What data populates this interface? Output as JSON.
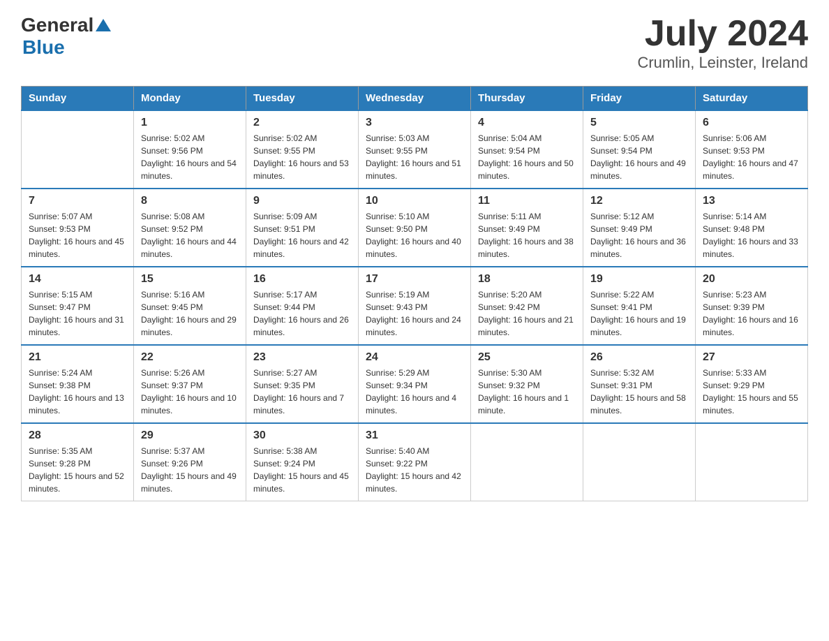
{
  "header": {
    "logo_general": "General",
    "logo_blue": "Blue",
    "month_year": "July 2024",
    "location": "Crumlin, Leinster, Ireland"
  },
  "days_of_week": [
    "Sunday",
    "Monday",
    "Tuesday",
    "Wednesday",
    "Thursday",
    "Friday",
    "Saturday"
  ],
  "weeks": [
    [
      {
        "day": "",
        "sunrise": "",
        "sunset": "",
        "daylight": ""
      },
      {
        "day": "1",
        "sunrise": "Sunrise: 5:02 AM",
        "sunset": "Sunset: 9:56 PM",
        "daylight": "Daylight: 16 hours and 54 minutes."
      },
      {
        "day": "2",
        "sunrise": "Sunrise: 5:02 AM",
        "sunset": "Sunset: 9:55 PM",
        "daylight": "Daylight: 16 hours and 53 minutes."
      },
      {
        "day": "3",
        "sunrise": "Sunrise: 5:03 AM",
        "sunset": "Sunset: 9:55 PM",
        "daylight": "Daylight: 16 hours and 51 minutes."
      },
      {
        "day": "4",
        "sunrise": "Sunrise: 5:04 AM",
        "sunset": "Sunset: 9:54 PM",
        "daylight": "Daylight: 16 hours and 50 minutes."
      },
      {
        "day": "5",
        "sunrise": "Sunrise: 5:05 AM",
        "sunset": "Sunset: 9:54 PM",
        "daylight": "Daylight: 16 hours and 49 minutes."
      },
      {
        "day": "6",
        "sunrise": "Sunrise: 5:06 AM",
        "sunset": "Sunset: 9:53 PM",
        "daylight": "Daylight: 16 hours and 47 minutes."
      }
    ],
    [
      {
        "day": "7",
        "sunrise": "Sunrise: 5:07 AM",
        "sunset": "Sunset: 9:53 PM",
        "daylight": "Daylight: 16 hours and 45 minutes."
      },
      {
        "day": "8",
        "sunrise": "Sunrise: 5:08 AM",
        "sunset": "Sunset: 9:52 PM",
        "daylight": "Daylight: 16 hours and 44 minutes."
      },
      {
        "day": "9",
        "sunrise": "Sunrise: 5:09 AM",
        "sunset": "Sunset: 9:51 PM",
        "daylight": "Daylight: 16 hours and 42 minutes."
      },
      {
        "day": "10",
        "sunrise": "Sunrise: 5:10 AM",
        "sunset": "Sunset: 9:50 PM",
        "daylight": "Daylight: 16 hours and 40 minutes."
      },
      {
        "day": "11",
        "sunrise": "Sunrise: 5:11 AM",
        "sunset": "Sunset: 9:49 PM",
        "daylight": "Daylight: 16 hours and 38 minutes."
      },
      {
        "day": "12",
        "sunrise": "Sunrise: 5:12 AM",
        "sunset": "Sunset: 9:49 PM",
        "daylight": "Daylight: 16 hours and 36 minutes."
      },
      {
        "day": "13",
        "sunrise": "Sunrise: 5:14 AM",
        "sunset": "Sunset: 9:48 PM",
        "daylight": "Daylight: 16 hours and 33 minutes."
      }
    ],
    [
      {
        "day": "14",
        "sunrise": "Sunrise: 5:15 AM",
        "sunset": "Sunset: 9:47 PM",
        "daylight": "Daylight: 16 hours and 31 minutes."
      },
      {
        "day": "15",
        "sunrise": "Sunrise: 5:16 AM",
        "sunset": "Sunset: 9:45 PM",
        "daylight": "Daylight: 16 hours and 29 minutes."
      },
      {
        "day": "16",
        "sunrise": "Sunrise: 5:17 AM",
        "sunset": "Sunset: 9:44 PM",
        "daylight": "Daylight: 16 hours and 26 minutes."
      },
      {
        "day": "17",
        "sunrise": "Sunrise: 5:19 AM",
        "sunset": "Sunset: 9:43 PM",
        "daylight": "Daylight: 16 hours and 24 minutes."
      },
      {
        "day": "18",
        "sunrise": "Sunrise: 5:20 AM",
        "sunset": "Sunset: 9:42 PM",
        "daylight": "Daylight: 16 hours and 21 minutes."
      },
      {
        "day": "19",
        "sunrise": "Sunrise: 5:22 AM",
        "sunset": "Sunset: 9:41 PM",
        "daylight": "Daylight: 16 hours and 19 minutes."
      },
      {
        "day": "20",
        "sunrise": "Sunrise: 5:23 AM",
        "sunset": "Sunset: 9:39 PM",
        "daylight": "Daylight: 16 hours and 16 minutes."
      }
    ],
    [
      {
        "day": "21",
        "sunrise": "Sunrise: 5:24 AM",
        "sunset": "Sunset: 9:38 PM",
        "daylight": "Daylight: 16 hours and 13 minutes."
      },
      {
        "day": "22",
        "sunrise": "Sunrise: 5:26 AM",
        "sunset": "Sunset: 9:37 PM",
        "daylight": "Daylight: 16 hours and 10 minutes."
      },
      {
        "day": "23",
        "sunrise": "Sunrise: 5:27 AM",
        "sunset": "Sunset: 9:35 PM",
        "daylight": "Daylight: 16 hours and 7 minutes."
      },
      {
        "day": "24",
        "sunrise": "Sunrise: 5:29 AM",
        "sunset": "Sunset: 9:34 PM",
        "daylight": "Daylight: 16 hours and 4 minutes."
      },
      {
        "day": "25",
        "sunrise": "Sunrise: 5:30 AM",
        "sunset": "Sunset: 9:32 PM",
        "daylight": "Daylight: 16 hours and 1 minute."
      },
      {
        "day": "26",
        "sunrise": "Sunrise: 5:32 AM",
        "sunset": "Sunset: 9:31 PM",
        "daylight": "Daylight: 15 hours and 58 minutes."
      },
      {
        "day": "27",
        "sunrise": "Sunrise: 5:33 AM",
        "sunset": "Sunset: 9:29 PM",
        "daylight": "Daylight: 15 hours and 55 minutes."
      }
    ],
    [
      {
        "day": "28",
        "sunrise": "Sunrise: 5:35 AM",
        "sunset": "Sunset: 9:28 PM",
        "daylight": "Daylight: 15 hours and 52 minutes."
      },
      {
        "day": "29",
        "sunrise": "Sunrise: 5:37 AM",
        "sunset": "Sunset: 9:26 PM",
        "daylight": "Daylight: 15 hours and 49 minutes."
      },
      {
        "day": "30",
        "sunrise": "Sunrise: 5:38 AM",
        "sunset": "Sunset: 9:24 PM",
        "daylight": "Daylight: 15 hours and 45 minutes."
      },
      {
        "day": "31",
        "sunrise": "Sunrise: 5:40 AM",
        "sunset": "Sunset: 9:22 PM",
        "daylight": "Daylight: 15 hours and 42 minutes."
      },
      {
        "day": "",
        "sunrise": "",
        "sunset": "",
        "daylight": ""
      },
      {
        "day": "",
        "sunrise": "",
        "sunset": "",
        "daylight": ""
      },
      {
        "day": "",
        "sunrise": "",
        "sunset": "",
        "daylight": ""
      }
    ]
  ]
}
